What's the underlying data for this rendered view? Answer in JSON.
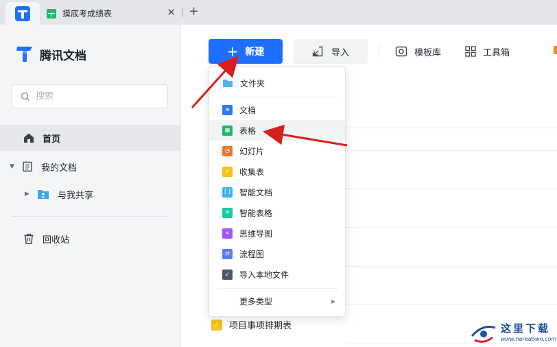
{
  "tab": {
    "title": "摸底考成绩表",
    "close": "✕",
    "add": "+"
  },
  "brand": {
    "name": "腾讯文档"
  },
  "search": {
    "placeholder": "搜索"
  },
  "sidebar": {
    "home": "首页",
    "my_docs": "我的文档",
    "shared": "与我共享",
    "trash": "回收站"
  },
  "toolbar": {
    "new_label": "新建",
    "new_plus": "+",
    "import_label": "导入",
    "templates_label": "模板库",
    "tools_label": "工具箱"
  },
  "menu": {
    "items": [
      {
        "label": "文件夹",
        "icon": "folder-icon",
        "color": "#4ab2f5"
      },
      {
        "label": "文档",
        "icon": "doc-icon",
        "color": "#2f7bf5"
      },
      {
        "label": "表格",
        "icon": "sheet-icon",
        "color": "#1fb86a"
      },
      {
        "label": "幻灯片",
        "icon": "slides-icon",
        "color": "#f0772e"
      },
      {
        "label": "收集表",
        "icon": "form-icon",
        "color": "#f5c31b"
      },
      {
        "label": "智能文档",
        "icon": "smart-doc-icon",
        "color": "#38b6f0"
      },
      {
        "label": "智能表格",
        "icon": "smart-sheet-icon",
        "color": "#1dc9a6"
      },
      {
        "label": "思维导图",
        "icon": "mindmap-icon",
        "color": "#a256f0"
      },
      {
        "label": "流程图",
        "icon": "flowchart-icon",
        "color": "#5a7cf5"
      },
      {
        "label": "导入本地文件",
        "icon": "import-local-icon",
        "color": "#4b5866"
      }
    ],
    "more_label": "更多类型",
    "more_arrow": "▶"
  },
  "recent": {
    "last_item": "项目事项排期表"
  },
  "colors": {
    "accent": "#1e6fff",
    "annotation_arrow": "#d81e1e"
  },
  "watermark": {
    "text": "这里下载",
    "url": "www.heredown.com"
  }
}
